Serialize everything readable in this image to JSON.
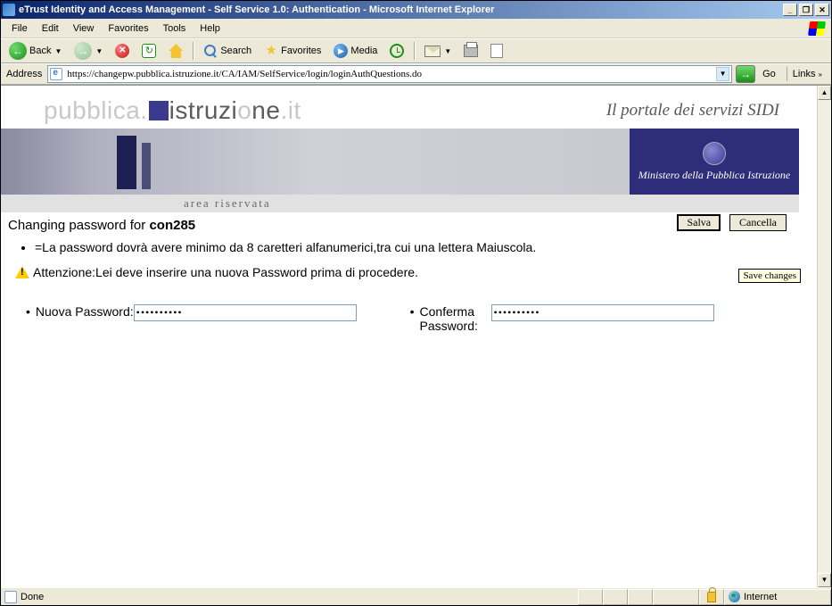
{
  "window": {
    "title": "eTrust Identity and Access Management - Self Service 1.0: Authentication - Microsoft Internet Explorer"
  },
  "menubar": {
    "file": "File",
    "edit": "Edit",
    "view": "View",
    "favorites": "Favorites",
    "tools": "Tools",
    "help": "Help"
  },
  "toolbar": {
    "back": "Back",
    "search": "Search",
    "favorites": "Favorites",
    "media": "Media"
  },
  "addressbar": {
    "label": "Address",
    "url": "https://changepw.pubblica.istruzione.it/CA/IAM/SelfService/login/loginAuthQuestions.do",
    "go": "Go",
    "links": "Links"
  },
  "banner": {
    "logo_pre": "pubblica.",
    "logo_mid": "istruzi",
    "logo_o": "o",
    "logo_post": "ne",
    "logo_suffix": ".it",
    "portal": "Il portale dei servizi SIDI",
    "ministry": "Ministero della Pubblica Istruzione",
    "area": "area riservata"
  },
  "content": {
    "heading_prefix": "Changing password for ",
    "username": "con285",
    "btn_save": "Salva",
    "btn_cancel": "Cancella",
    "tooltip": "Save changes",
    "rule1": "=La password dovrà avere minimo da 8 caretteri alfanumerici,tra cui una lettera Maiuscola.",
    "warning": "Attenzione:Lei deve inserire una nuova Password prima di procedere.",
    "label_new": "Nuova Password:",
    "label_confirm": "Conferma Password:",
    "pw_value1": "••••••••••",
    "pw_value2": "••••••••••"
  },
  "statusbar": {
    "status": "Done",
    "zone": "Internet"
  }
}
